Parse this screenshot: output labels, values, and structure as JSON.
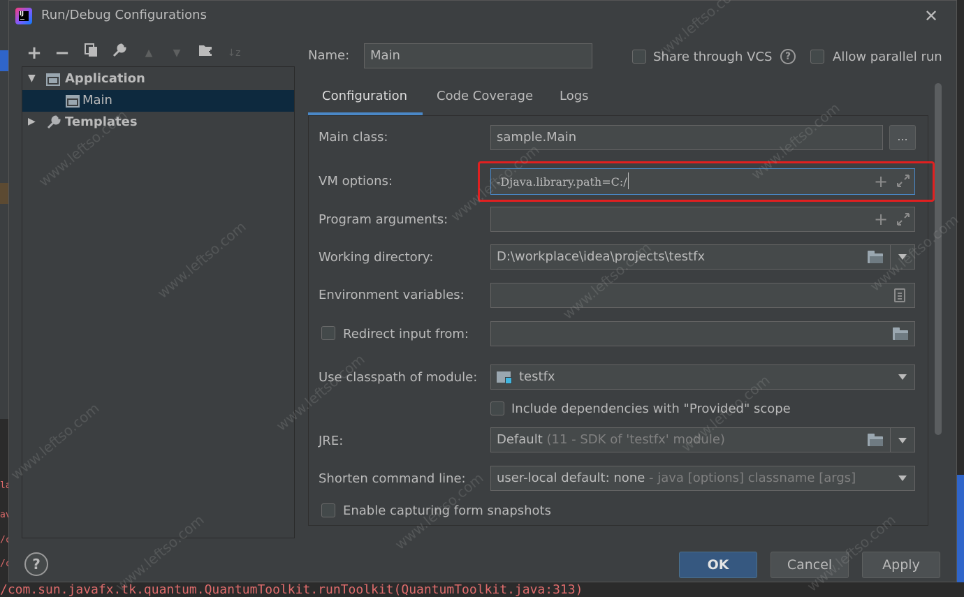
{
  "window": {
    "title": "Run/Debug Configurations"
  },
  "toolbar": {
    "add": "+",
    "remove": "−",
    "copy": "⧉",
    "edit": "🔧",
    "move_up": "▲",
    "move_down": "▼",
    "folder": "📁",
    "sort": "↓z"
  },
  "tree": {
    "items": [
      {
        "label": "Application",
        "expanded": true
      },
      {
        "label": "Main",
        "selected": true
      },
      {
        "label": "Templates",
        "expanded": false
      }
    ]
  },
  "header": {
    "name_label": "Name:",
    "name_value": "Main",
    "share_label": "Share through VCS",
    "help_glyph": "?",
    "parallel_label": "Allow parallel run"
  },
  "tabs": [
    {
      "label": "Configuration",
      "active": true
    },
    {
      "label": "Code Coverage"
    },
    {
      "label": "Logs"
    }
  ],
  "config": {
    "main_class_label": "Main class:",
    "main_class_value": "sample.Main",
    "browse_label": "...",
    "vm_options_label": "VM options:",
    "vm_options_value": "-Djava.library.path=C:/",
    "program_args_label": "Program arguments:",
    "program_args_value": "",
    "working_dir_label": "Working directory:",
    "working_dir_value": "D:\\workplace\\idea\\projects\\testfx",
    "env_vars_label": "Environment variables:",
    "env_vars_value": "",
    "redirect_label": "Redirect input from:",
    "redirect_value": "",
    "classpath_label": "Use classpath of module:",
    "classpath_value": "testfx",
    "include_deps_label": "Include dependencies with \"Provided\" scope",
    "jre_label": "JRE:",
    "jre_value_main": "Default",
    "jre_value_hint": "(11 - SDK of 'testfx' module)",
    "shorten_label": "Shorten command line:",
    "shorten_value_main": "user-local default: none",
    "shorten_value_hint": "- java [options] classname [args]",
    "snapshots_label": "Enable capturing form snapshots"
  },
  "footer": {
    "help_glyph": "?",
    "ok": "OK",
    "cancel": "Cancel",
    "apply": "Apply"
  },
  "background": {
    "console_line": "/com.sun.javafx.tk.quantum.QuantumToolkit.runToolkit(QuantumToolkit.java:313)",
    "console_chars": [
      "la",
      "av",
      "/c",
      "/c"
    ]
  },
  "watermark": "www.leftso.com",
  "colors": {
    "dialog_bg": "#3c3f41",
    "selection": "#0d293e",
    "accent": "#4a88c7",
    "highlight_box": "#e02020",
    "primary_button": "#365880",
    "console_error": "#e06c6c"
  }
}
